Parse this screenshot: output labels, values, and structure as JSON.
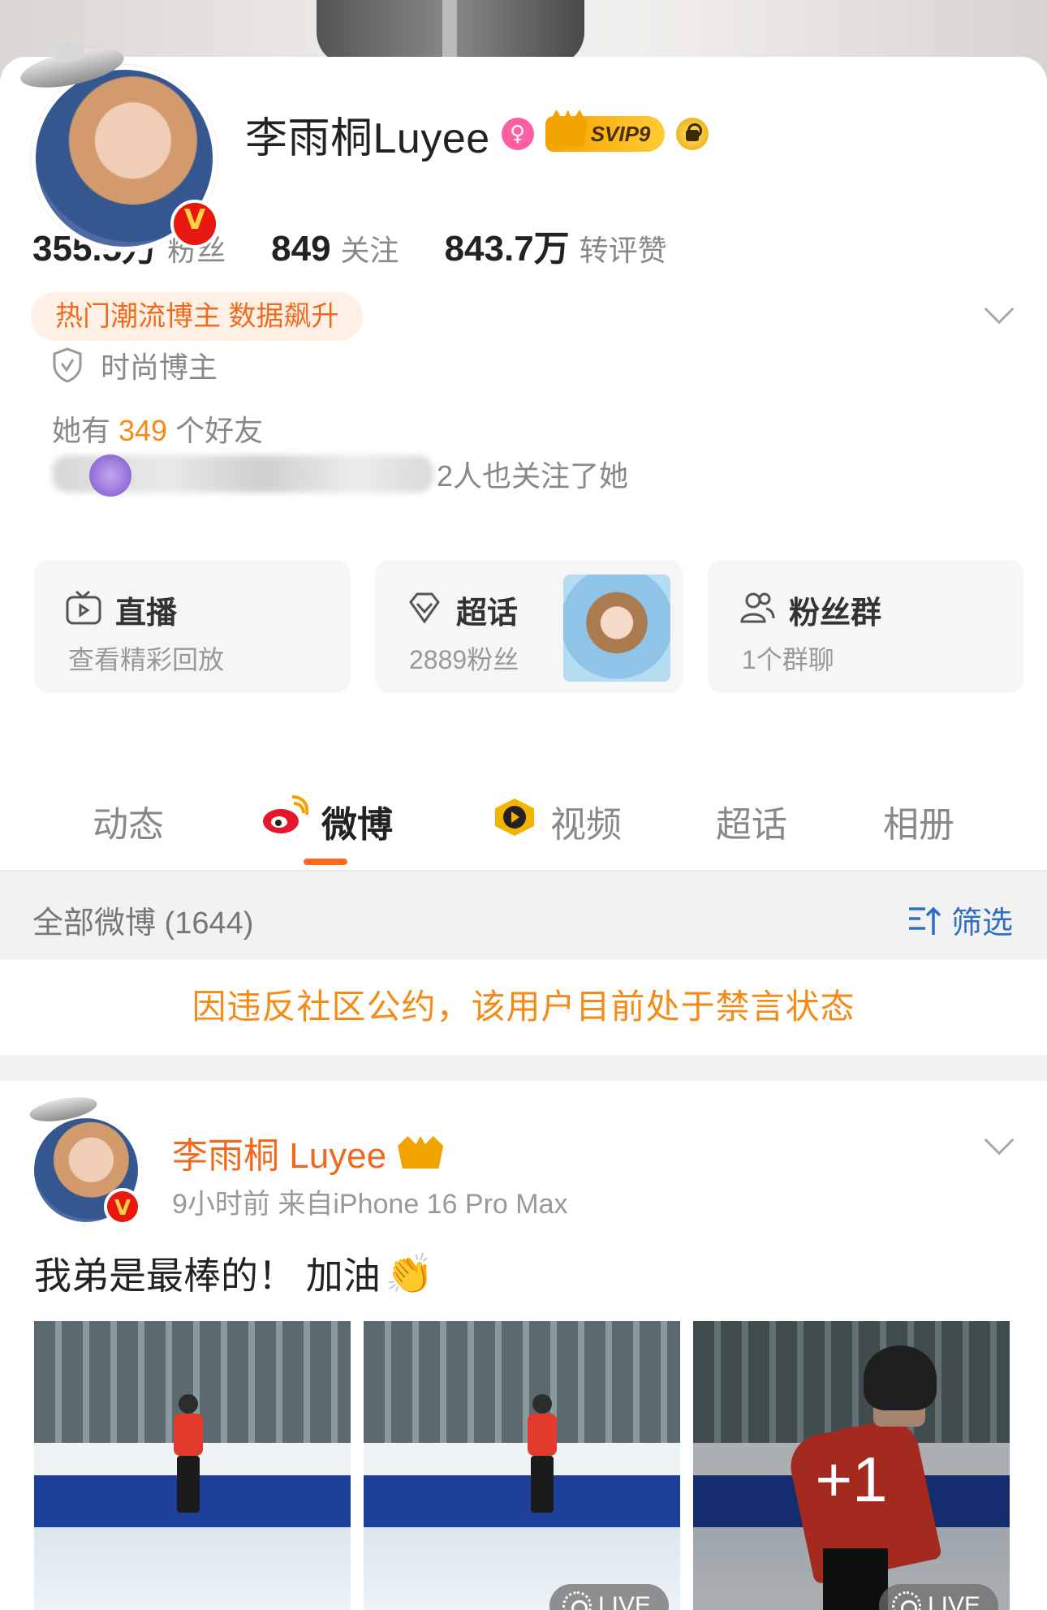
{
  "profile": {
    "name": "李雨桐Luyee",
    "gender_icon": "female-icon",
    "svip_label": "SVIP9",
    "verified_badge": "V",
    "stats": [
      {
        "value": "355.5万",
        "label": "粉丝"
      },
      {
        "value": "849",
        "label": "关注"
      },
      {
        "value": "843.7万",
        "label": "转评赞"
      }
    ],
    "hot_tag": "热门潮流博主 数据飙升",
    "certification": "时尚博主",
    "friends_prefix": "她有",
    "friends_count": "349",
    "friends_suffix": "个好友",
    "mutual_suffix": "2人也关注了她"
  },
  "features": {
    "live": {
      "title": "直播",
      "subtitle": "查看精彩回放"
    },
    "super": {
      "title": "超话",
      "subtitle": "2889粉丝"
    },
    "fans": {
      "title": "粉丝群",
      "subtitle": "1个群聊"
    }
  },
  "tabs": [
    {
      "label": "动态"
    },
    {
      "label": "微博"
    },
    {
      "label": "视频"
    },
    {
      "label": "超话"
    },
    {
      "label": "相册"
    }
  ],
  "filter_bar": {
    "all_label": "全部微博 (1644)",
    "filter_label": "筛选"
  },
  "banned_notice": "因违反社区公约，该用户目前处于禁言状态",
  "post": {
    "author": "李雨桐 Luyee",
    "meta": "9小时前   来自iPhone 16 Pro Max",
    "text": "我弟是最棒的！ 加油",
    "emoji": "👏",
    "more_count": "+1",
    "live_label": "LIVE"
  },
  "colors": {
    "accent": "#f58a16",
    "tab_underline": "#ff6a1a",
    "link_blue": "#2f6fbf",
    "hot_tag_bg": "#fff0e6"
  }
}
